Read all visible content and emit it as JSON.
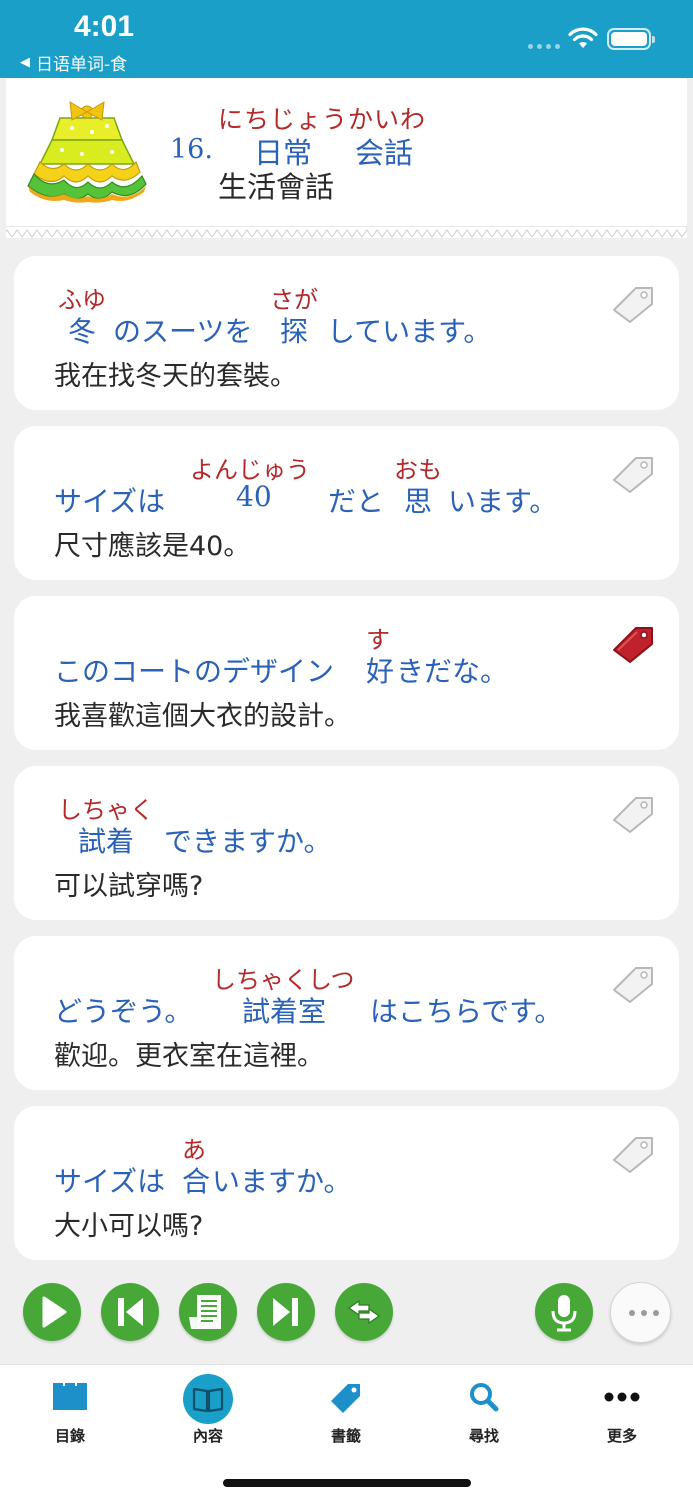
{
  "status_bar": {
    "time": "4:01",
    "back_label": "日语单词-食",
    "back_icon": "back-triangle-icon"
  },
  "header": {
    "lesson_number": "16.",
    "ruby": "にちじょうかいわ",
    "word1": "日常",
    "word2": "会話",
    "translation": "生活會話"
  },
  "colors": {
    "accent": "#1aa0c8",
    "button_green": "#47a838",
    "japanese_text": "#2a62b8",
    "ruby_text": "#b22a2a",
    "bookmark_active": "#c0212a"
  },
  "cards": [
    {
      "ruby": [
        "ふゆ",
        "さが"
      ],
      "jp": [
        "冬",
        "のスーツを",
        "探",
        "しています。"
      ],
      "zh": "我在找冬天的套裝。",
      "bookmarked": false
    },
    {
      "ruby": [
        "よんじゅう",
        "おも"
      ],
      "jp": [
        "サイズは",
        "40",
        "だと",
        "思",
        "います。"
      ],
      "zh": "尺寸應該是40。",
      "bookmarked": false
    },
    {
      "ruby": [
        "す"
      ],
      "jp": [
        "このコートのデザイン",
        "好",
        "きだな。"
      ],
      "zh": "我喜歡這個大衣的設計。",
      "bookmarked": true
    },
    {
      "ruby": [
        "しちゃく"
      ],
      "jp": [
        "試着",
        "できますか。"
      ],
      "zh": "可以試穿嗎?",
      "bookmarked": false
    },
    {
      "ruby": [
        "しちゃくしつ"
      ],
      "jp": [
        "どうぞう。",
        "試着室",
        "はこちらです。"
      ],
      "zh": "歡迎。更衣室在這裡。",
      "bookmarked": false
    },
    {
      "ruby": [
        "あ"
      ],
      "jp": [
        "サイズは",
        "合",
        "いますか。"
      ],
      "zh": "大小可以嗎?",
      "bookmarked": false
    }
  ],
  "controls": [
    "play-icon",
    "previous-icon",
    "text-view-icon",
    "next-icon",
    "swap-language-icon",
    "microphone-icon",
    "more-dots-icon"
  ],
  "tabs": [
    {
      "label": "目錄",
      "icon": "catalog-icon",
      "active": false
    },
    {
      "label": "內容",
      "icon": "book-icon",
      "active": true
    },
    {
      "label": "書籤",
      "icon": "bookmark-tag-icon",
      "active": false
    },
    {
      "label": "尋找",
      "icon": "search-icon",
      "active": false
    },
    {
      "label": "更多",
      "icon": "more-dots-icon",
      "active": false
    }
  ]
}
